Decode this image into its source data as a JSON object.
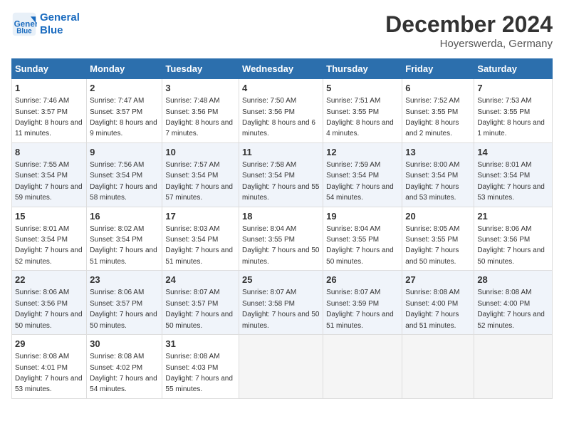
{
  "header": {
    "logo_line1": "General",
    "logo_line2": "Blue",
    "main_title": "December 2024",
    "subtitle": "Hoyerswerda, Germany"
  },
  "days_of_week": [
    "Sunday",
    "Monday",
    "Tuesday",
    "Wednesday",
    "Thursday",
    "Friday",
    "Saturday"
  ],
  "weeks": [
    [
      {
        "day": "1",
        "sunrise": "7:46 AM",
        "sunset": "3:57 PM",
        "daylight": "8 hours and 11 minutes."
      },
      {
        "day": "2",
        "sunrise": "7:47 AM",
        "sunset": "3:57 PM",
        "daylight": "8 hours and 9 minutes."
      },
      {
        "day": "3",
        "sunrise": "7:48 AM",
        "sunset": "3:56 PM",
        "daylight": "8 hours and 7 minutes."
      },
      {
        "day": "4",
        "sunrise": "7:50 AM",
        "sunset": "3:56 PM",
        "daylight": "8 hours and 6 minutes."
      },
      {
        "day": "5",
        "sunrise": "7:51 AM",
        "sunset": "3:55 PM",
        "daylight": "8 hours and 4 minutes."
      },
      {
        "day": "6",
        "sunrise": "7:52 AM",
        "sunset": "3:55 PM",
        "daylight": "8 hours and 2 minutes."
      },
      {
        "day": "7",
        "sunrise": "7:53 AM",
        "sunset": "3:55 PM",
        "daylight": "8 hours and 1 minute."
      }
    ],
    [
      {
        "day": "8",
        "sunrise": "7:55 AM",
        "sunset": "3:54 PM",
        "daylight": "7 hours and 59 minutes."
      },
      {
        "day": "9",
        "sunrise": "7:56 AM",
        "sunset": "3:54 PM",
        "daylight": "7 hours and 58 minutes."
      },
      {
        "day": "10",
        "sunrise": "7:57 AM",
        "sunset": "3:54 PM",
        "daylight": "7 hours and 57 minutes."
      },
      {
        "day": "11",
        "sunrise": "7:58 AM",
        "sunset": "3:54 PM",
        "daylight": "7 hours and 55 minutes."
      },
      {
        "day": "12",
        "sunrise": "7:59 AM",
        "sunset": "3:54 PM",
        "daylight": "7 hours and 54 minutes."
      },
      {
        "day": "13",
        "sunrise": "8:00 AM",
        "sunset": "3:54 PM",
        "daylight": "7 hours and 53 minutes."
      },
      {
        "day": "14",
        "sunrise": "8:01 AM",
        "sunset": "3:54 PM",
        "daylight": "7 hours and 53 minutes."
      }
    ],
    [
      {
        "day": "15",
        "sunrise": "8:01 AM",
        "sunset": "3:54 PM",
        "daylight": "7 hours and 52 minutes."
      },
      {
        "day": "16",
        "sunrise": "8:02 AM",
        "sunset": "3:54 PM",
        "daylight": "7 hours and 51 minutes."
      },
      {
        "day": "17",
        "sunrise": "8:03 AM",
        "sunset": "3:54 PM",
        "daylight": "7 hours and 51 minutes."
      },
      {
        "day": "18",
        "sunrise": "8:04 AM",
        "sunset": "3:55 PM",
        "daylight": "7 hours and 50 minutes."
      },
      {
        "day": "19",
        "sunrise": "8:04 AM",
        "sunset": "3:55 PM",
        "daylight": "7 hours and 50 minutes."
      },
      {
        "day": "20",
        "sunrise": "8:05 AM",
        "sunset": "3:55 PM",
        "daylight": "7 hours and 50 minutes."
      },
      {
        "day": "21",
        "sunrise": "8:06 AM",
        "sunset": "3:56 PM",
        "daylight": "7 hours and 50 minutes."
      }
    ],
    [
      {
        "day": "22",
        "sunrise": "8:06 AM",
        "sunset": "3:56 PM",
        "daylight": "7 hours and 50 minutes."
      },
      {
        "day": "23",
        "sunrise": "8:06 AM",
        "sunset": "3:57 PM",
        "daylight": "7 hours and 50 minutes."
      },
      {
        "day": "24",
        "sunrise": "8:07 AM",
        "sunset": "3:57 PM",
        "daylight": "7 hours and 50 minutes."
      },
      {
        "day": "25",
        "sunrise": "8:07 AM",
        "sunset": "3:58 PM",
        "daylight": "7 hours and 50 minutes."
      },
      {
        "day": "26",
        "sunrise": "8:07 AM",
        "sunset": "3:59 PM",
        "daylight": "7 hours and 51 minutes."
      },
      {
        "day": "27",
        "sunrise": "8:08 AM",
        "sunset": "4:00 PM",
        "daylight": "7 hours and 51 minutes."
      },
      {
        "day": "28",
        "sunrise": "8:08 AM",
        "sunset": "4:00 PM",
        "daylight": "7 hours and 52 minutes."
      }
    ],
    [
      {
        "day": "29",
        "sunrise": "8:08 AM",
        "sunset": "4:01 PM",
        "daylight": "7 hours and 53 minutes."
      },
      {
        "day": "30",
        "sunrise": "8:08 AM",
        "sunset": "4:02 PM",
        "daylight": "7 hours and 54 minutes."
      },
      {
        "day": "31",
        "sunrise": "8:08 AM",
        "sunset": "4:03 PM",
        "daylight": "7 hours and 55 minutes."
      },
      null,
      null,
      null,
      null
    ]
  ],
  "labels": {
    "sunrise": "Sunrise:",
    "sunset": "Sunset:",
    "daylight": "Daylight:"
  }
}
